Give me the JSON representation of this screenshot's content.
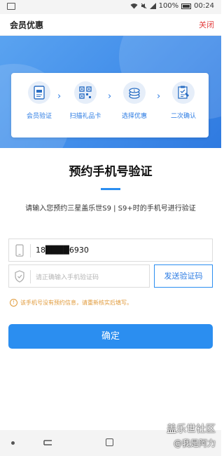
{
  "status_bar": {
    "battery": "100%",
    "time": "00:24"
  },
  "header": {
    "title": "会员优惠",
    "close_label": "关闭"
  },
  "steps": [
    {
      "label": "会员验证",
      "icon": "certificate-icon"
    },
    {
      "label": "扫描礼品卡",
      "icon": "qr-code-icon"
    },
    {
      "label": "选择优惠",
      "icon": "coins-icon"
    },
    {
      "label": "二次确认",
      "icon": "document-check-icon"
    }
  ],
  "main": {
    "title": "预约手机号验证",
    "subtitle": "请输入您预约三星盖乐世S9 | S9+时的手机号进行验证"
  },
  "form": {
    "phone_value": "18████6930",
    "code_placeholder": "请正确输入手机验证码",
    "send_code_label": "发送验证码",
    "warning": "该手机号没有预约信息，请重新核实后填写。",
    "confirm_label": "确定"
  },
  "watermark": {
    "site": "盖乐世社区",
    "user": "@我是阿力"
  },
  "colors": {
    "accent": "#2b8ef0",
    "close": "#e23c3c",
    "warning": "#e09a3a"
  }
}
